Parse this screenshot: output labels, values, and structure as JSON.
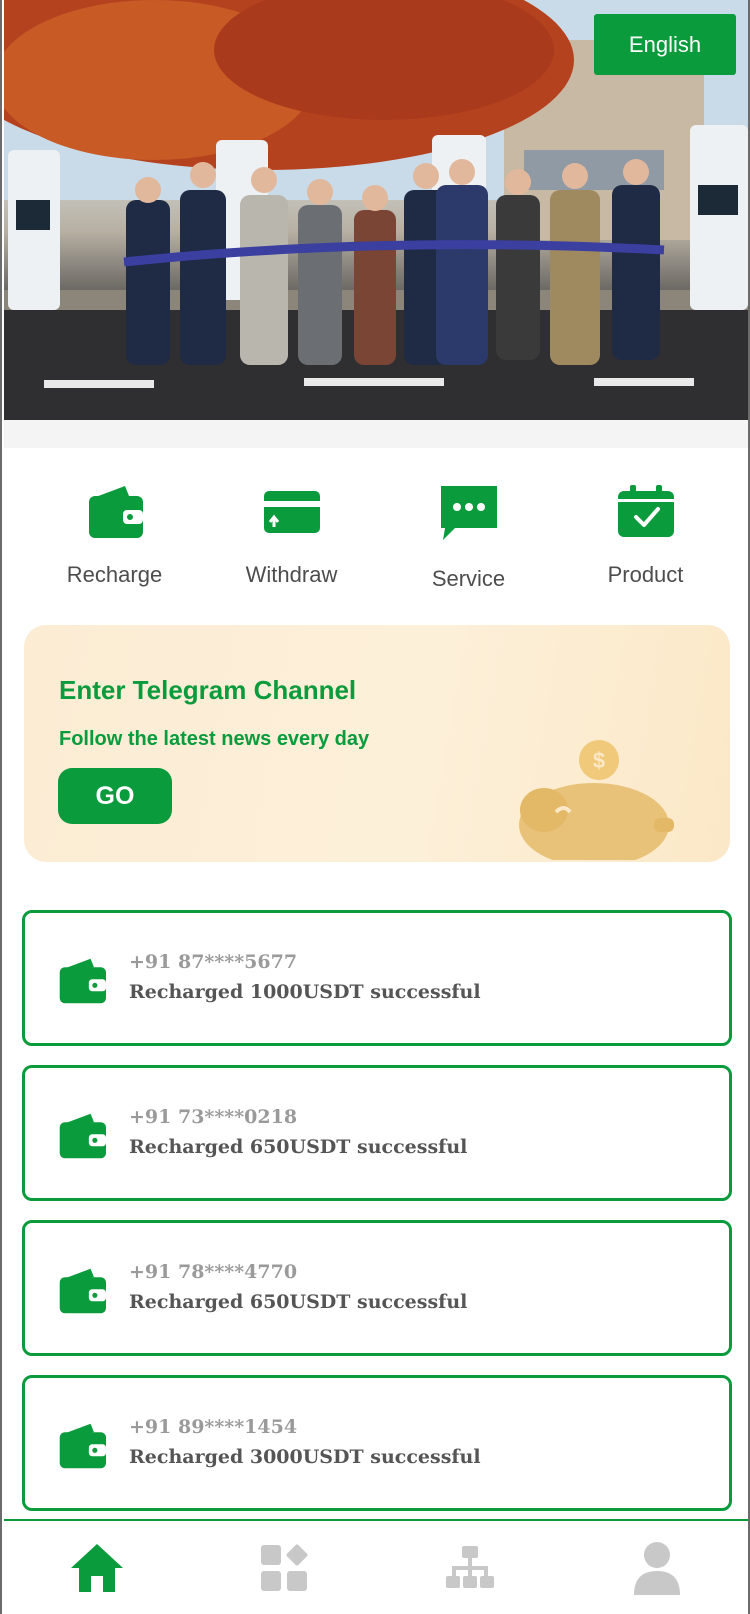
{
  "header": {
    "language_button": "English"
  },
  "hero": {
    "photo_description_icon": "hero-photo"
  },
  "actions": [
    {
      "label": "Recharge",
      "icon": "wallet-icon"
    },
    {
      "label": "Withdraw",
      "icon": "card-upload-icon"
    },
    {
      "label": "Service",
      "icon": "chat-bubble-icon"
    },
    {
      "label": "Product",
      "icon": "calendar-check-icon"
    }
  ],
  "banner": {
    "title": "Enter Telegram Channel",
    "subtitle": "Follow the latest news every day",
    "button": "GO"
  },
  "records": [
    {
      "phone": "+91 87****5677",
      "message": "Recharged 1000USDT successful"
    },
    {
      "phone": "+91 73****0218",
      "message": "Recharged 650USDT successful"
    },
    {
      "phone": "+91 78****4770",
      "message": "Recharged 650USDT successful"
    },
    {
      "phone": "+91 89****1454",
      "message": "Recharged 3000USDT successful"
    }
  ],
  "bottom_nav": [
    {
      "icon": "home-icon",
      "active": true
    },
    {
      "icon": "apps-icon",
      "active": false
    },
    {
      "icon": "team-structure-icon",
      "active": false
    },
    {
      "icon": "user-icon",
      "active": false
    }
  ],
  "colors": {
    "brand_green": "#0a9b3c",
    "inactive_gray": "#c8c8c8",
    "banner_bg": "#fdf0d9"
  }
}
